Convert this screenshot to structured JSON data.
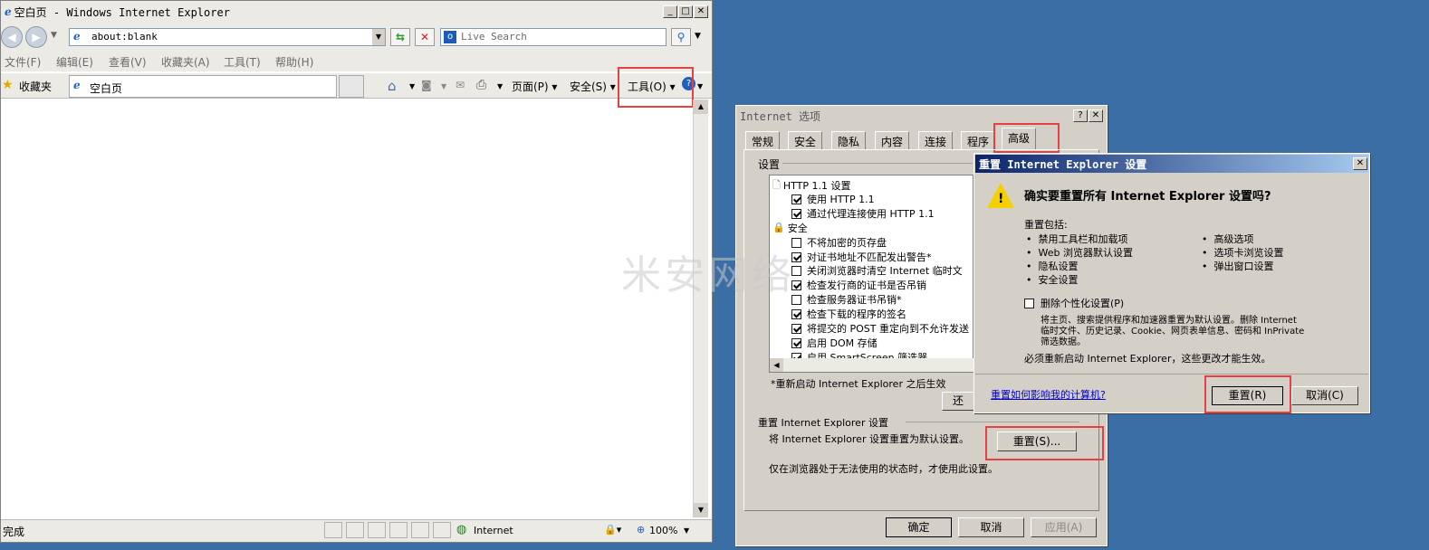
{
  "ie": {
    "title": "空白页 - Windows Internet Explorer",
    "address": "about:blank",
    "search_placeholder": "Live Search",
    "menu": [
      "文件(F)",
      "编辑(E)",
      "查看(V)",
      "收藏夹(A)",
      "工具(T)",
      "帮助(H)"
    ],
    "favorites_label": "收藏夹",
    "tab_label": "空白页",
    "cmd": {
      "page": "页面(P)",
      "safety": "安全(S)",
      "tools": "工具(O)"
    },
    "status": {
      "text": "完成",
      "zone": "Internet",
      "zoom": "100%"
    }
  },
  "options": {
    "title": "Internet 选项",
    "tabs": [
      "常规",
      "安全",
      "隐私",
      "内容",
      "连接",
      "程序",
      "高级"
    ],
    "settings_label": "设置",
    "settings": [
      {
        "type": "group",
        "label": "HTTP 1.1 设置"
      },
      {
        "type": "check",
        "checked": true,
        "label": "使用 HTTP 1.1"
      },
      {
        "type": "check",
        "checked": true,
        "label": "通过代理连接使用 HTTP 1.1"
      },
      {
        "type": "group",
        "label": "安全"
      },
      {
        "type": "check",
        "checked": false,
        "label": "不将加密的页存盘"
      },
      {
        "type": "check",
        "checked": true,
        "label": "对证书地址不匹配发出警告*"
      },
      {
        "type": "check",
        "checked": false,
        "label": "关闭浏览器时清空 Internet 临时文"
      },
      {
        "type": "check",
        "checked": true,
        "label": "检查发行商的证书是否吊销"
      },
      {
        "type": "check",
        "checked": false,
        "label": "检查服务器证书吊销*"
      },
      {
        "type": "check",
        "checked": true,
        "label": "检查下载的程序的签名"
      },
      {
        "type": "check",
        "checked": true,
        "label": "将提交的 POST 重定向到不允许发送"
      },
      {
        "type": "check",
        "checked": true,
        "label": "启用 DOM 存储"
      },
      {
        "type": "check",
        "checked": true,
        "label": "启用 SmartScreen 筛选器"
      }
    ],
    "restart_note": "*重新启动 Internet Explorer 之后生效",
    "restore_label": "还",
    "reset_group": "重置 Internet Explorer 设置",
    "reset_desc": "将 Internet Explorer 设置重置为默认设置。",
    "reset_button": "重置(S)...",
    "reset_hint": "仅在浏览器处于无法使用的状态时，才使用此设置。",
    "ok": "确定",
    "cancel": "取消",
    "apply": "应用(A)"
  },
  "reset_dialog": {
    "title": "重置 Internet Explorer 设置",
    "question": "确实要重置所有 Internet Explorer 设置吗?",
    "includes_label": "重置包括:",
    "items_left": [
      "禁用工具栏和加载项",
      "Web 浏览器默认设置",
      "隐私设置",
      "安全设置"
    ],
    "items_right": [
      "高级选项",
      "选项卡浏览设置",
      "弹出窗口设置"
    ],
    "personal_label": "删除个性化设置(P)",
    "personal_desc_1": "将主页、搜索提供程序和加速器重置为默认设置。删除 Internet",
    "personal_desc_2": "临时文件、历史记录、Cookie、网页表单信息、密码和 InPrivate",
    "personal_desc_3": "筛选数据。",
    "restart_note": "必须重新启动 Internet Explorer，这些更改才能生效。",
    "link": "重置如何影响我的计算机?",
    "reset_button": "重置(R)",
    "cancel_button": "取消(C)"
  },
  "watermark": "米安网络",
  "colors": {
    "desktop": "#3a6ea5",
    "highlight": "#e84040",
    "dialog_title": "#0a246a"
  }
}
